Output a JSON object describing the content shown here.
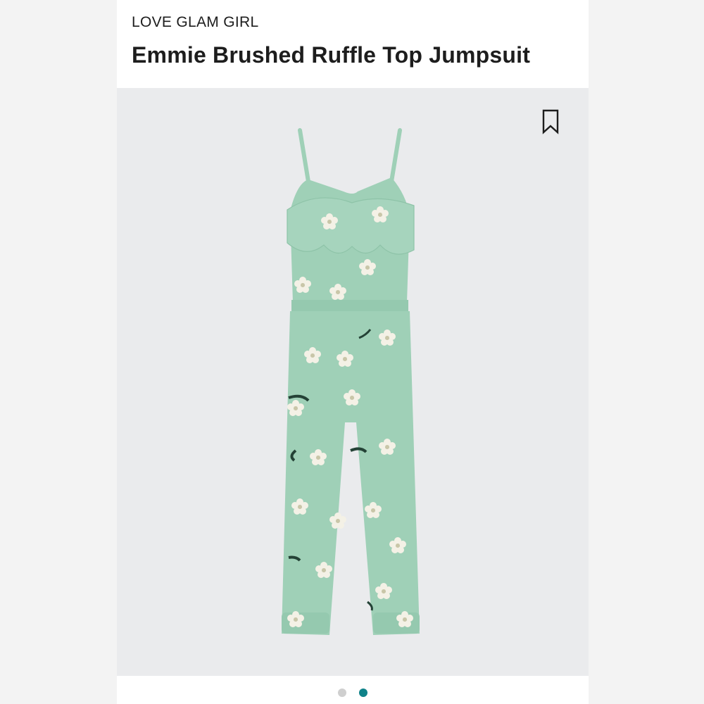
{
  "product": {
    "brand": "LOVE GLAM GIRL",
    "name": "Emmie Brushed Ruffle Top Jumpsuit"
  },
  "colors": {
    "garment": "#9fd0b7",
    "background": "#eaebed",
    "active_dot": "#0f8289",
    "inactive_dot": "#cfcfcf"
  },
  "icons": {
    "bookmark": "bookmark-icon"
  },
  "carousel": {
    "total": 2,
    "active_index": 2
  }
}
